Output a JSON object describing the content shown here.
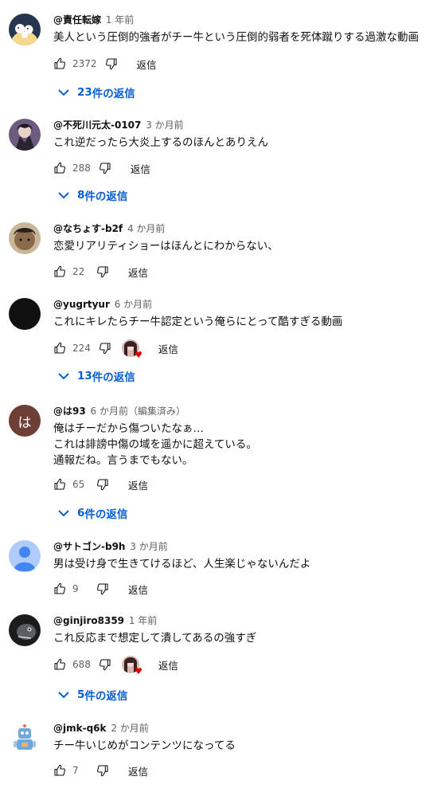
{
  "ui": {
    "replies_suffix": " 件の返信"
  },
  "comments": [
    {
      "author": "@責任転嫁",
      "time": "1 年前",
      "text": "美人という圧倒的強者がチー牛という圧倒的弱者を死体蹴りする過激な動画",
      "likes": "2372",
      "reply": "返信",
      "replies": "23"
    },
    {
      "author": "@不死川元太-0107",
      "time": "3 か月前",
      "text": "これ逆だったら大炎上するのほんとありえん",
      "likes": "288",
      "reply": "返信",
      "replies": "8"
    },
    {
      "author": "@なちょす-b2f",
      "time": "4 か月前",
      "text": "恋愛リアリティショーはほんとにわからない、",
      "likes": "22",
      "reply": "返信"
    },
    {
      "author": "@yugrtyur",
      "time": "6 か月前",
      "text": "これにキレたらチー牛認定という俺らにとって酷すぎる動画",
      "likes": "224",
      "reply": "返信",
      "replies": "13"
    },
    {
      "author": "@は93",
      "time": "6 か月前（編集済み）",
      "avatar_letter": "は",
      "text1": "俺はチーだから傷ついたなぁ…",
      "text2": "これは誹謗中傷の域を遥かに超えている。",
      "text3": "通報だね。言うまでもない。",
      "likes": "65",
      "reply": "返信",
      "replies": "6"
    },
    {
      "author": "@サトゴン-b9h",
      "time": "3 か月前",
      "text": "男は受け身で生きてけるほど、人生楽じゃないんだよ",
      "likes": "9",
      "reply": "返信"
    },
    {
      "author": "@ginjiro8359",
      "time": "1 年前",
      "text": "これ反応まで想定して潰してあるの強すぎ",
      "likes": "688",
      "reply": "返信",
      "replies": "5"
    },
    {
      "author": "@jmk-q6k",
      "time": "2 か月前",
      "text": "チー牛いじめがコンテンツになってる",
      "likes": "7",
      "reply": "返信"
    }
  ],
  "colors": {
    "link": "#065fd4",
    "meta": "#606060",
    "heart": "#e00000"
  },
  "icons": [
    "thumb-up-icon",
    "thumb-down-icon",
    "chevron-down-icon",
    "heart-icon",
    "default-person-icon"
  ]
}
